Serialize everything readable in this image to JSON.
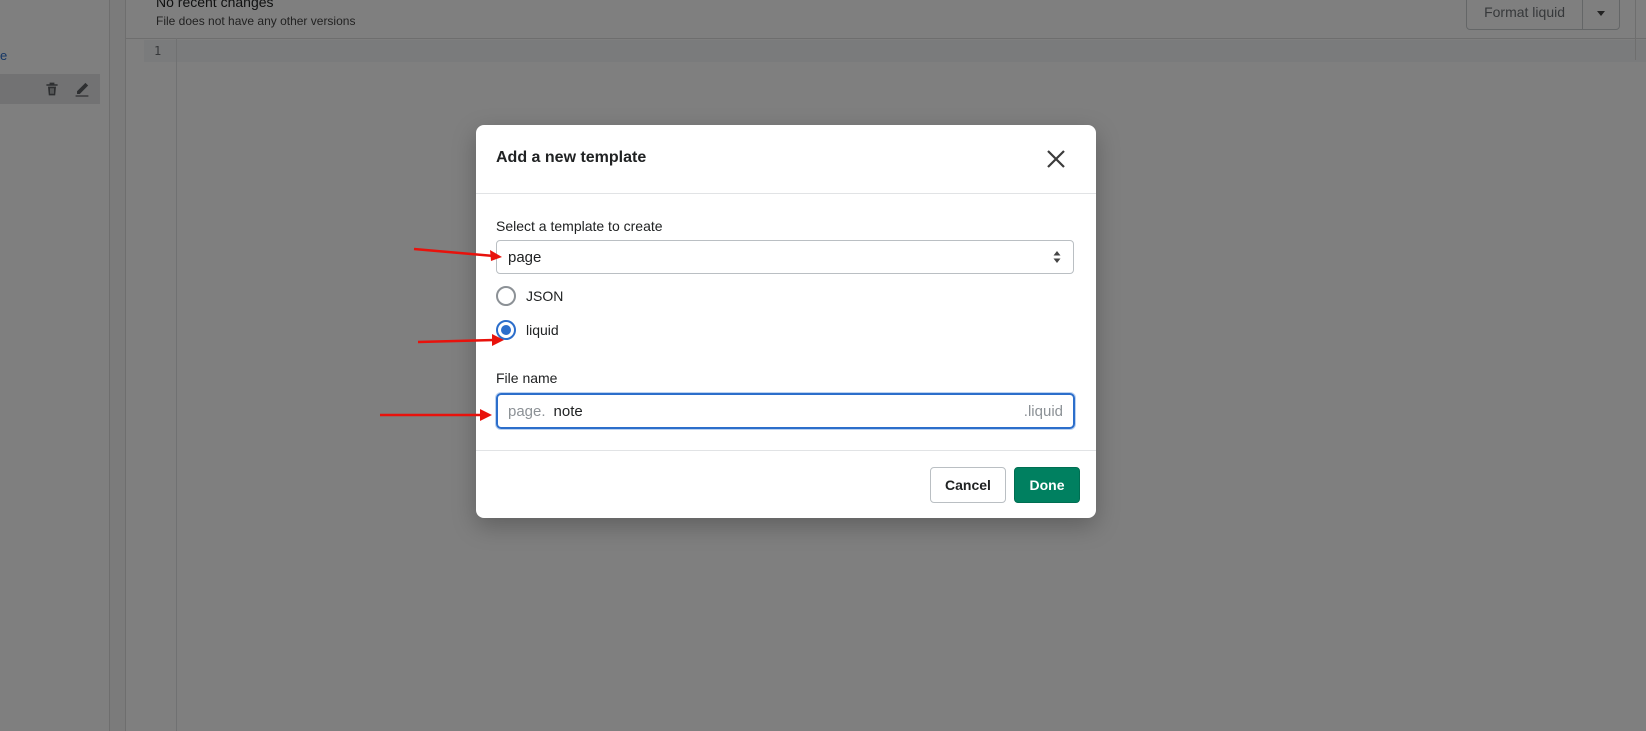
{
  "background": {
    "sidebar": {
      "link_text": "e"
    },
    "editor": {
      "status": "No recent changes",
      "versions": "File does not have any other versions",
      "format_button": "Format liquid",
      "line_number": "1"
    }
  },
  "modal": {
    "title": "Add a new template",
    "select_label": "Select a template to create",
    "select_value": "page",
    "radio_options": [
      {
        "label": "JSON",
        "checked": false
      },
      {
        "label": "liquid",
        "checked": true
      }
    ],
    "file_name_label": "File name",
    "file_prefix": "page.",
    "file_value": "note",
    "file_suffix": ".liquid",
    "cancel_label": "Cancel",
    "done_label": "Done"
  },
  "colors": {
    "accent": "#2c6ecb",
    "primary_button": "#008060",
    "annotation_arrow": "#e8120c"
  },
  "icons": [
    "trash-icon",
    "pencil-icon",
    "caret-down-icon",
    "close-icon",
    "select-caret-icon"
  ]
}
